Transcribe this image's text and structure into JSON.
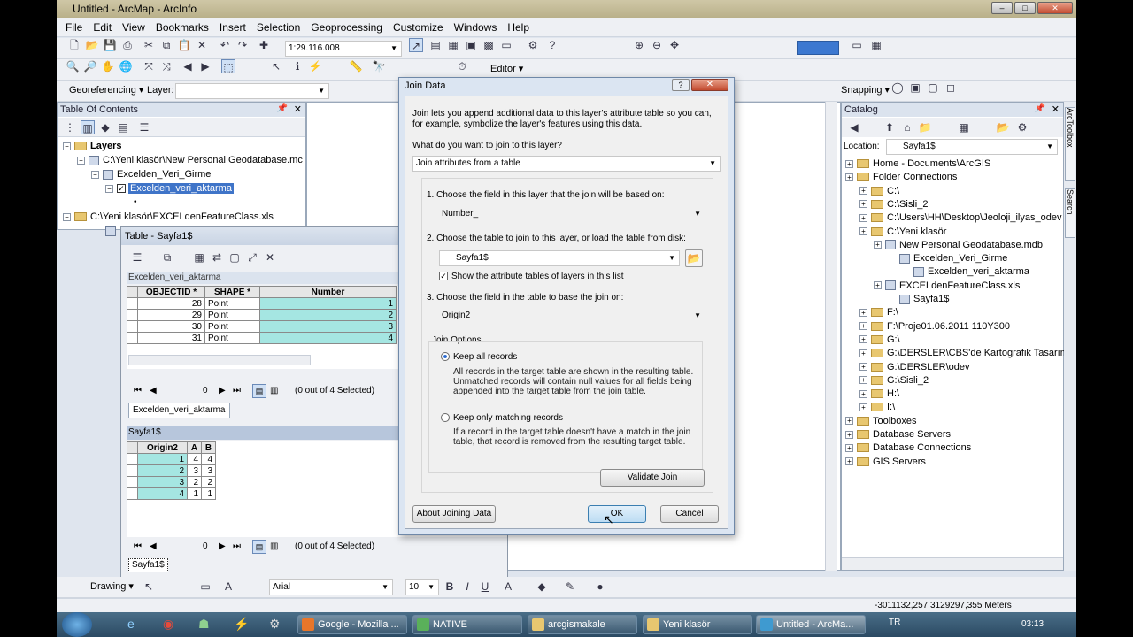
{
  "window": {
    "title": "Untitled - ArcMap - ArcInfo"
  },
  "menu": [
    "File",
    "Edit",
    "View",
    "Bookmarks",
    "Insert",
    "Selection",
    "Geoprocessing",
    "Customize",
    "Windows",
    "Help"
  ],
  "toolbar": {
    "scale": "1:29.116.008",
    "georeferencing": "Georeferencing ▾",
    "layer_label": "Layer:",
    "editor": "Editor ▾",
    "snapping": "Snapping ▾",
    "drawing": "Drawing ▾",
    "font": "Arial",
    "font_size": "10"
  },
  "toc": {
    "title": "Table Of Contents",
    "layers": "Layers",
    "gdb_path": "C:\\Yeni klasör\\New Personal Geodatabase.mc",
    "dataset": "Excelden_Veri_Girme",
    "layer": "Excelden_veri_aktarma",
    "xls_path": "C:\\Yeni klasör\\EXCELdenFeatureClass.xls"
  },
  "table_window": {
    "title": "Table - Sayfa1$",
    "top_table_name": "Excelden_veri_aktarma",
    "top_columns": [
      "OBJECTID *",
      "SHAPE *",
      "Number"
    ],
    "top_rows": [
      [
        "28",
        "Point",
        "1"
      ],
      [
        "29",
        "Point",
        "2"
      ],
      [
        "30",
        "Point",
        "3"
      ],
      [
        "31",
        "Point",
        "4"
      ]
    ],
    "nav_value": "0",
    "selection_status": "(0 out of 4 Selected)",
    "tab_top": "Excelden_veri_aktarma",
    "bottom_table_name": "Sayfa1$",
    "bottom_columns": [
      "Origin2",
      "A",
      "B"
    ],
    "bottom_rows": [
      [
        "1",
        "4",
        "4"
      ],
      [
        "2",
        "3",
        "3"
      ],
      [
        "3",
        "2",
        "2"
      ],
      [
        "4",
        "1",
        "1"
      ]
    ],
    "nav_value_2": "0",
    "selection_status_2": "(0 out of 4 Selected)",
    "tab_bottom": "Sayfa1$"
  },
  "dialog": {
    "title": "Join Data",
    "intro": "Join lets you append additional data to this layer's attribute table so you can, for example, symbolize the layer's features using this data.",
    "question": "What do you want to join to this layer?",
    "join_type": "Join attributes from a table",
    "step1": "1.  Choose the field in this layer that the join will be based on:",
    "field1": "Number_",
    "step2": "2.  Choose the table to join to this layer, or load the table from disk:",
    "table2": "Sayfa1$",
    "show_attr": "Show the attribute tables of layers in this list",
    "step3": "3.  Choose the field in the table to base the join on:",
    "field3": "Origin2",
    "join_options": "Join Options",
    "keep_all": "Keep all records",
    "keep_all_desc": "All records in the target table are shown in the resulting table. Unmatched records will contain null values for all fields being appended into the target table from the join table.",
    "keep_matching": "Keep only matching records",
    "keep_matching_desc": "If a record in the target table doesn't have a match in the join table, that record is removed from the resulting target table.",
    "validate": "Validate Join",
    "about": "About Joining Data",
    "ok": "OK",
    "cancel": "Cancel"
  },
  "catalog": {
    "title": "Catalog",
    "location_label": "Location:",
    "location_value": "Sayfa1$",
    "items": [
      {
        "label": "Home - Documents\\ArcGIS",
        "level": 0
      },
      {
        "label": "Folder Connections",
        "level": 0
      },
      {
        "label": "C:\\",
        "level": 1
      },
      {
        "label": "C:\\Sisli_2",
        "level": 1
      },
      {
        "label": "C:\\Users\\HH\\Desktop\\Jeoloji_ilyas_odev",
        "level": 1
      },
      {
        "label": "C:\\Yeni klasör",
        "level": 1
      },
      {
        "label": "New Personal Geodatabase.mdb",
        "level": 2
      },
      {
        "label": "Excelden_Veri_Girme",
        "level": 3
      },
      {
        "label": "Excelden_veri_aktarma",
        "level": 4
      },
      {
        "label": "EXCELdenFeatureClass.xls",
        "level": 2
      },
      {
        "label": "Sayfa1$",
        "level": 3
      },
      {
        "label": "F:\\",
        "level": 1
      },
      {
        "label": "F:\\Proje01.06.2011 110Y300",
        "level": 1
      },
      {
        "label": "G:\\",
        "level": 1
      },
      {
        "label": "G:\\DERSLER\\CBS'de Kartografik Tasarım",
        "level": 1
      },
      {
        "label": "G:\\DERSLER\\odev",
        "level": 1
      },
      {
        "label": "G:\\Sisli_2",
        "level": 1
      },
      {
        "label": "H:\\",
        "level": 1
      },
      {
        "label": "I:\\",
        "level": 1
      },
      {
        "label": "Toolboxes",
        "level": 0
      },
      {
        "label": "Database Servers",
        "level": 0
      },
      {
        "label": "Database Connections",
        "level": 0
      },
      {
        "label": "GIS Servers",
        "level": 0
      }
    ],
    "side_tabs": [
      "ArcToolbox",
      "Search"
    ]
  },
  "status": {
    "coords": "-3011132,257  3129297,355 Meters"
  },
  "taskbar": {
    "tasks": [
      "Google - Mozilla ...",
      "NATIVE",
      "arcgismakale",
      "Yeni klasör",
      "Untitled - ArcMa..."
    ],
    "lang": "TR",
    "time": "03:13"
  }
}
